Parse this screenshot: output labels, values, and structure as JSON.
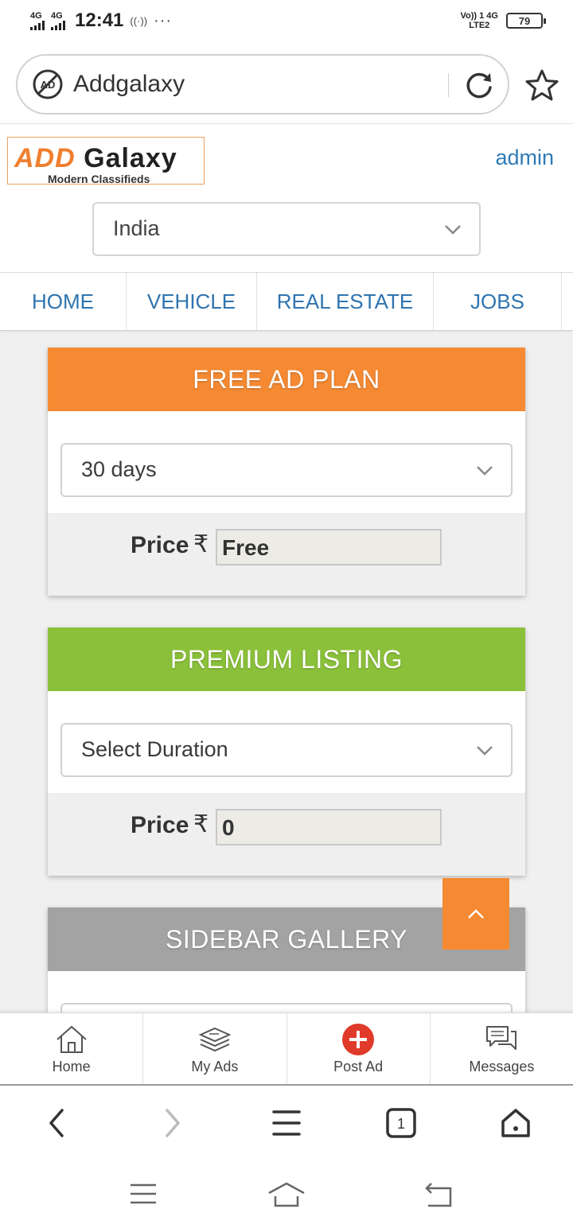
{
  "status_bar": {
    "sim1_label": "4G",
    "sim2_label": "4G",
    "time": "12:41",
    "hotspot": "((·))",
    "more": "···",
    "volte_top": "Vo)) 1 4G",
    "volte_bottom": "LTE2",
    "battery": "79"
  },
  "browser": {
    "url_text": "Addgalaxy",
    "adblock_icon": "ad-block-icon",
    "reload_icon": "reload-icon",
    "bookmark_icon": "star-icon"
  },
  "site": {
    "logo_add": "ADD",
    "logo_galaxy": "Galaxy",
    "logo_tagline": "Modern Classifieds",
    "admin_link": "admin",
    "country_select": "India",
    "accent_orange": "#f58a33",
    "link_blue": "#2f74b0"
  },
  "nav": {
    "items": [
      "HOME",
      "VEHICLE",
      "REAL ESTATE",
      "JOBS"
    ]
  },
  "plans": [
    {
      "title": "FREE AD PLAN",
      "header_color": "#f58a33",
      "duration_value": "30 days",
      "price_label": "Price",
      "currency": "₹",
      "price_value": "Free"
    },
    {
      "title": "PREMIUM LISTING",
      "header_color": "#8bc13a",
      "duration_value": "Select Duration",
      "price_label": "Price",
      "currency": "₹",
      "price_value": "0"
    },
    {
      "title": "SIDEBAR GALLERY",
      "header_color": "#a3a3a3"
    }
  ],
  "app_nav": {
    "items": [
      {
        "label": "Home",
        "icon": "home-icon"
      },
      {
        "label": "My Ads",
        "icon": "stack-icon"
      },
      {
        "label": "Post Ad",
        "icon": "plus-circle-icon"
      },
      {
        "label": "Messages",
        "icon": "chat-icon"
      }
    ]
  },
  "browser_tools": {
    "tab_count": "1"
  }
}
